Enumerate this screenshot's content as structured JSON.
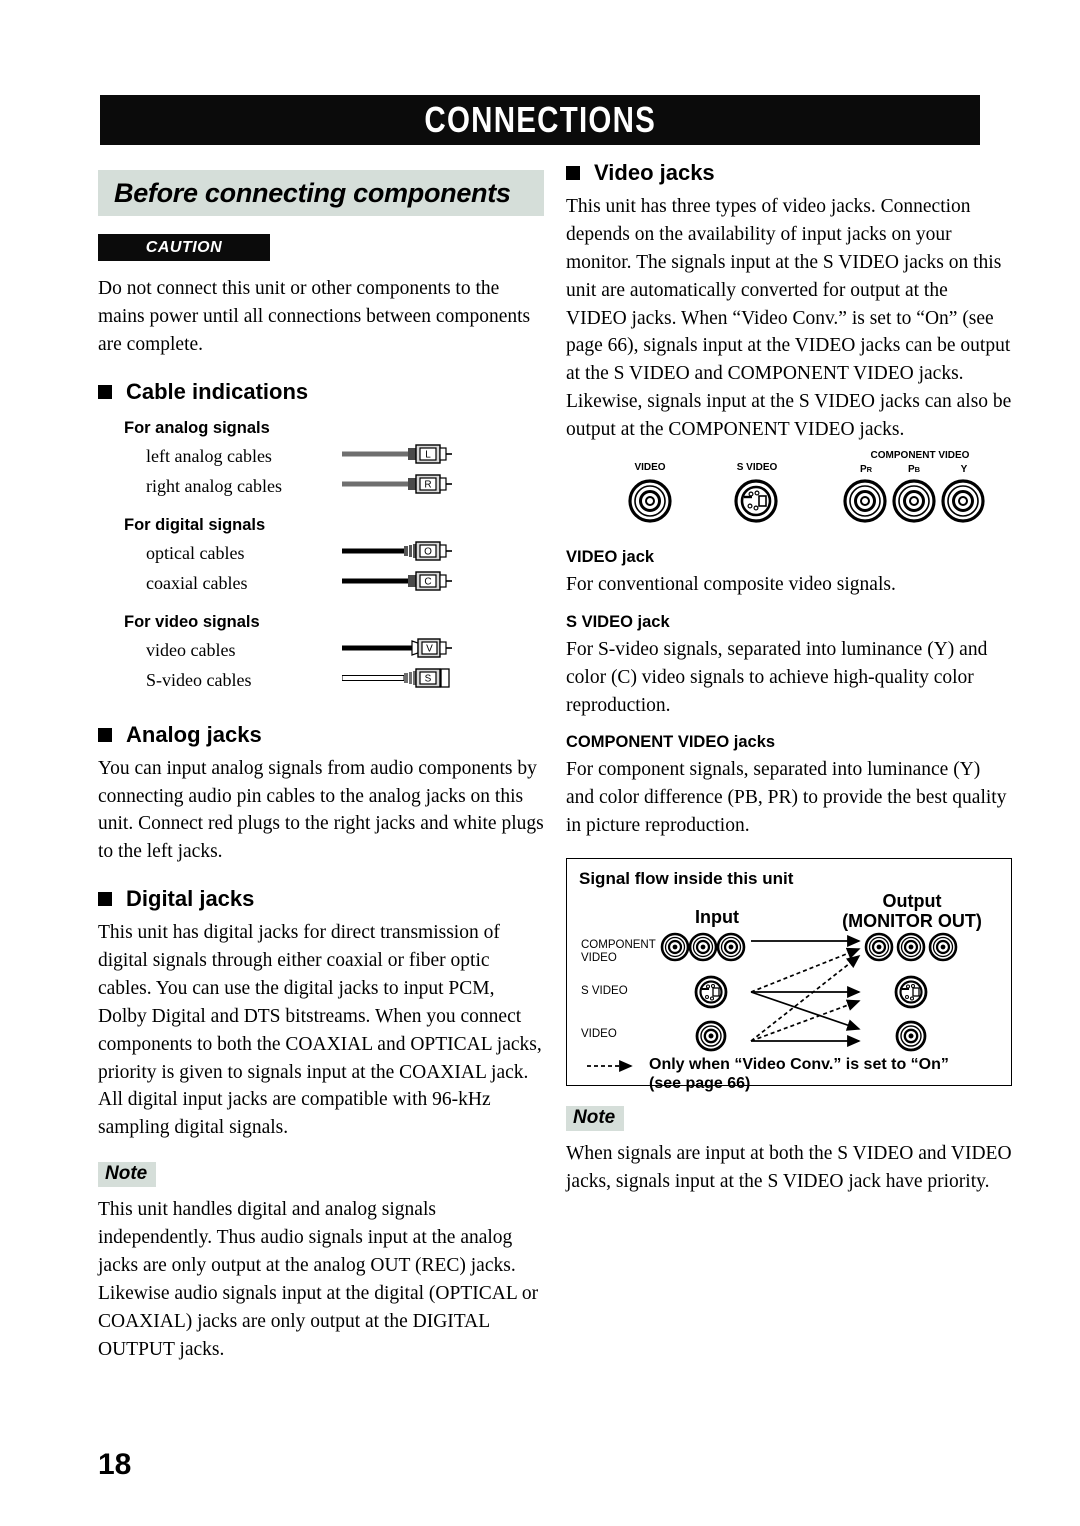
{
  "header": {
    "title": "CONNECTIONS"
  },
  "page_number": "18",
  "colors": {
    "banner_bg": "#d5ded9",
    "bar_bg": "#0b0b0b",
    "text": "#000000"
  },
  "left_column": {
    "section_banner": "Before connecting components",
    "caution_label": "CAUTION",
    "caution_text": "Do not connect this unit or other components to the mains power until all connections between components are complete.",
    "cable_indications": {
      "heading": "Cable indications",
      "groups": [
        {
          "title": "For analog signals",
          "cables": [
            {
              "label": "left analog cables",
              "code": "L",
              "style": "gray"
            },
            {
              "label": "right analog cables",
              "code": "R",
              "style": "gray"
            }
          ]
        },
        {
          "title": "For digital signals",
          "cables": [
            {
              "label": "optical cables",
              "code": "O",
              "style": "black-optical"
            },
            {
              "label": "coaxial cables",
              "code": "C",
              "style": "black"
            }
          ]
        },
        {
          "title": "For video signals",
          "cables": [
            {
              "label": "video cables",
              "code": "V",
              "style": "black"
            },
            {
              "label": "S-video cables",
              "code": "S",
              "style": "outline"
            }
          ]
        }
      ]
    },
    "analog_jacks": {
      "heading": "Analog jacks",
      "text": "You can input analog signals from audio components by connecting audio pin cables to the analog jacks on this unit. Connect red plugs to the right jacks and white plugs to the left jacks."
    },
    "digital_jacks": {
      "heading": "Digital jacks",
      "text": "This unit has digital jacks for direct transmission of digital signals through either coaxial or fiber optic cables. You can use the digital jacks to input PCM, Dolby Digital and DTS bitstreams. When you connect components to both the COAXIAL and OPTICAL jacks, priority is given to signals input at the COAXIAL jack. All digital input jacks are compatible with 96-kHz sampling digital signals."
    },
    "note": {
      "label": "Note",
      "text": "This unit handles digital and analog signals independently. Thus audio signals input at the analog jacks are only output at the analog OUT (REC) jacks. Likewise audio signals input at the digital (OPTICAL or COAXIAL) jacks are only output at the DIGITAL OUTPUT jacks."
    }
  },
  "right_column": {
    "video_jacks": {
      "heading": "Video jacks",
      "text": "This unit has three types of video jacks. Connection depends on the availability of input jacks on your monitor. The signals input at the S VIDEO jacks on this unit are automatically converted for output at the VIDEO jacks. When “Video Conv.” is set to “On” (see page 66), signals input at the VIDEO jacks can be output at the S VIDEO and COMPONENT VIDEO jacks. Likewise, signals input at the S VIDEO jacks can also be output at the COMPONENT VIDEO jacks."
    },
    "jack_diagram": {
      "video_label": "VIDEO",
      "svideo_label": "S VIDEO",
      "component_label": "COMPONENT VIDEO",
      "component_pins": [
        "PR",
        "PB",
        "Y"
      ]
    },
    "video_jack": {
      "heading": "VIDEO jack",
      "text": "For conventional composite video signals."
    },
    "svideo_jack": {
      "heading": "S VIDEO jack",
      "text": "For S-video signals, separated into luminance (Y) and color (C) video signals to achieve high-quality color reproduction."
    },
    "component_jacks": {
      "heading": "COMPONENT VIDEO jacks",
      "text": "For component signals, separated into luminance (Y) and color difference (PB, PR) to provide the best quality in picture reproduction."
    },
    "signal_flow": {
      "title": "Signal flow inside this unit",
      "input_label": "Input",
      "output_label_1": "Output",
      "output_label_2": "(MONITOR OUT)",
      "rows": [
        "COMPONENT VIDEO",
        "S VIDEO",
        "VIDEO"
      ],
      "legend_line_1": "Only when “Video Conv.” is set to “On”",
      "legend_line_2": "(see page 66)"
    },
    "note": {
      "label": "Note",
      "text": "When signals are input at both the S VIDEO and VIDEO jacks, signals input at the S VIDEO jack have priority."
    }
  }
}
